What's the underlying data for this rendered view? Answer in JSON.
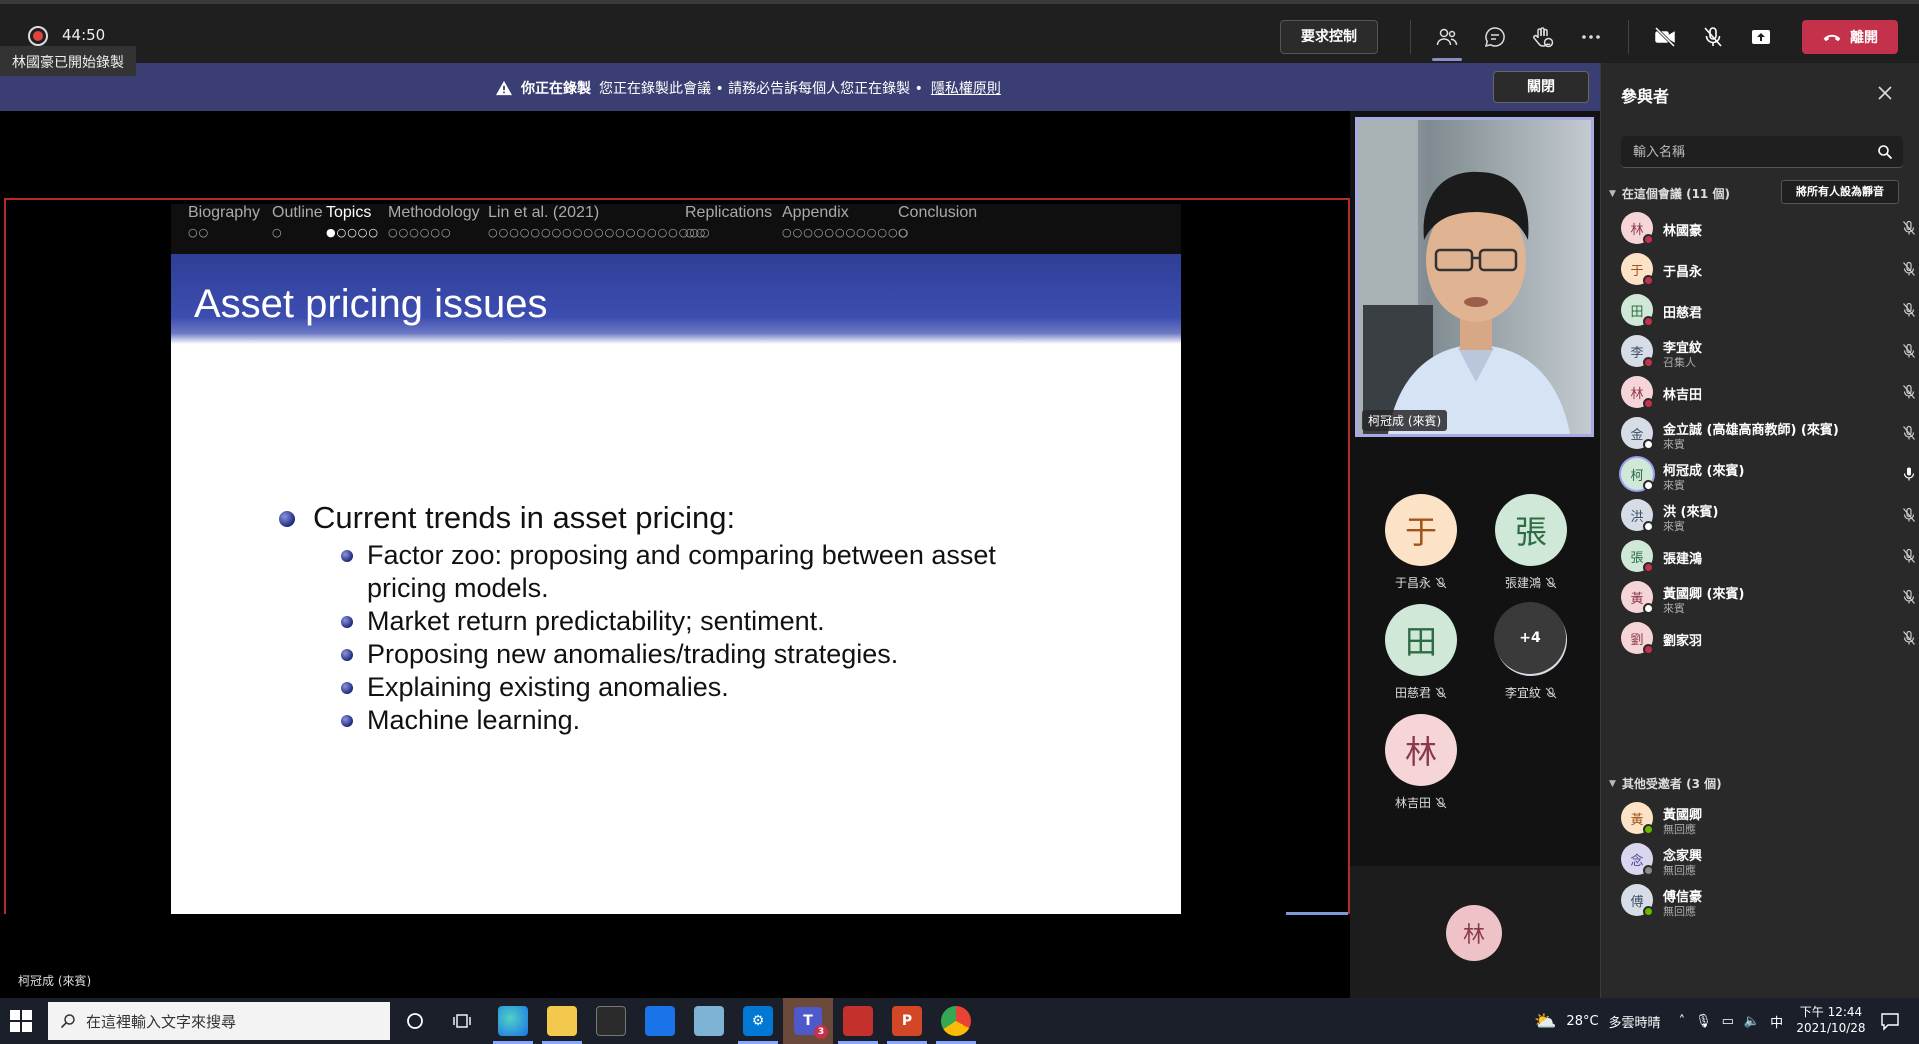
{
  "top_bar": {
    "timer": "44:50",
    "recording_toast": "林國豪已開始錄製",
    "request_control_label": "要求控制",
    "leave_label": "離開",
    "icons": [
      "people-icon",
      "chat-icon",
      "reactions-icon",
      "more-icon",
      "camera-off-icon",
      "mic-off-icon",
      "share-tray-icon"
    ]
  },
  "recording_banner": {
    "bold_text": "你正在錄製",
    "message": "您正在錄製此會議 • 請務必告訴每個人您正在錄製 •",
    "privacy_link": "隱私權原則",
    "close_label": "關閉"
  },
  "slide": {
    "nav_sections": [
      {
        "label": "Biography",
        "dots": "○○"
      },
      {
        "label": "Outline",
        "dots": "○"
      },
      {
        "label": "Topics",
        "dots": "●○○○○",
        "active": true
      },
      {
        "label": "Methodology",
        "dots": "○○○○○○"
      },
      {
        "label": "Lin et al. (2021)",
        "dots": "○○○○○○○○○○○○○○○○○○○○○"
      },
      {
        "label": "Replications",
        "dots": "○○"
      },
      {
        "label": "Appendix",
        "dots": "○○○○○○○○○○○○"
      },
      {
        "label": "Conclusion",
        "dots": "○"
      }
    ],
    "title": "Asset pricing issues",
    "main_bullet": "Current trends in asset pricing:",
    "sub_bullets": [
      "Factor zoo: proposing and comparing between asset pricing models.",
      "Market return predictability; sentiment.",
      "Proposing new anomalies/trading strategies.",
      "Explaining existing anomalies.",
      "Machine learning."
    ]
  },
  "presenter_tag": "柯冠成 (來賓)",
  "video": {
    "name": "柯冠成 (來賓)"
  },
  "gallery": [
    {
      "initial": "于",
      "name": "于昌永",
      "bg": "#fce2c6",
      "fg": "#a0541a"
    },
    {
      "initial": "張",
      "name": "張建鴻",
      "bg": "#cfe8d7",
      "fg": "#2f6b45"
    },
    {
      "initial": "田",
      "name": "田慈君",
      "bg": "#cfe8d7",
      "fg": "#2f6b45"
    },
    {
      "initial": "李",
      "name": "李宜紋",
      "bg": "#d6dde6",
      "fg": "#3f5064"
    },
    {
      "initial": "林",
      "name": "林吉田",
      "bg": "#f6d5d9",
      "fg": "#8a3a4a"
    }
  ],
  "gallery_overflow": "+4",
  "self_initial": "林",
  "panel": {
    "title": "參與者",
    "search_placeholder": "輸入名稱",
    "in_meeting_header": "在這個會議 (11 個)",
    "mute_all_label": "將所有人設為靜音",
    "in_meeting": [
      {
        "initial": "林",
        "name": "林國豪",
        "role": "",
        "bg": "#f6d5d9",
        "fg": "#8a3a4a",
        "status": "#c4314b"
      },
      {
        "initial": "于",
        "name": "于昌永",
        "role": "",
        "bg": "#fce2c6",
        "fg": "#a0541a",
        "status": "#c4314b"
      },
      {
        "initial": "田",
        "name": "田慈君",
        "role": "",
        "bg": "#cfe8d7",
        "fg": "#2f6b45",
        "status": "#c4314b"
      },
      {
        "initial": "李",
        "name": "李宜紋",
        "role": "召集人",
        "bg": "#d6dde6",
        "fg": "#3f5064",
        "status": "#c4314b"
      },
      {
        "initial": "林",
        "name": "林吉田",
        "role": "",
        "bg": "#f6d5d9",
        "fg": "#8a3a4a",
        "status": "#c4314b"
      },
      {
        "initial": "金",
        "name": "金立誠 (高雄高商教師) (來賓)",
        "role": "來賓",
        "bg": "#d6dde6",
        "fg": "#3f5064",
        "status": "#ffffff"
      },
      {
        "initial": "柯",
        "name": "柯冠成 (來賓)",
        "role": "來賓",
        "bg": "#cfe8d7",
        "fg": "#2f6b45",
        "status": "#ffffff",
        "speaking": true
      },
      {
        "initial": "洪",
        "name": "洪 (來賓)",
        "role": "來賓",
        "bg": "#d6dde6",
        "fg": "#3f5064",
        "status": "#ffffff"
      },
      {
        "initial": "張",
        "name": "張建鴻",
        "role": "",
        "bg": "#cfe8d7",
        "fg": "#2f6b45",
        "status": "#c4314b"
      },
      {
        "initial": "黃",
        "name": "黃國卿 (來賓)",
        "role": "來賓",
        "bg": "#f6d5d9",
        "fg": "#8a3a4a",
        "status": "#ffffff"
      },
      {
        "initial": "劉",
        "name": "劉家羽",
        "role": "",
        "bg": "#f6d5d9",
        "fg": "#8a3a4a",
        "status": "#c4314b"
      }
    ],
    "others_header": "其他受邀者 (3 個)",
    "others": [
      {
        "initial": "黃",
        "name": "黃國卿",
        "role": "無回應",
        "bg": "#fce2c6",
        "fg": "#a0541a",
        "status": "#6bb700"
      },
      {
        "initial": "念",
        "name": "念家興",
        "role": "無回應",
        "bg": "#d9d6f0",
        "fg": "#4a4590",
        "status": "#8a8a8a"
      },
      {
        "initial": "傅",
        "name": "傅信豪",
        "role": "無回應",
        "bg": "#d6dde6",
        "fg": "#3f5064",
        "status": "#6bb700"
      }
    ]
  },
  "taskbar": {
    "search_placeholder": "在這裡輸入文字來搜尋",
    "weather_temp": "28°C",
    "weather_desc": "多雲時晴",
    "ime_indicator": "中",
    "time": "下午 12:44",
    "date": "2021/10/28",
    "teams_badge": "3"
  }
}
